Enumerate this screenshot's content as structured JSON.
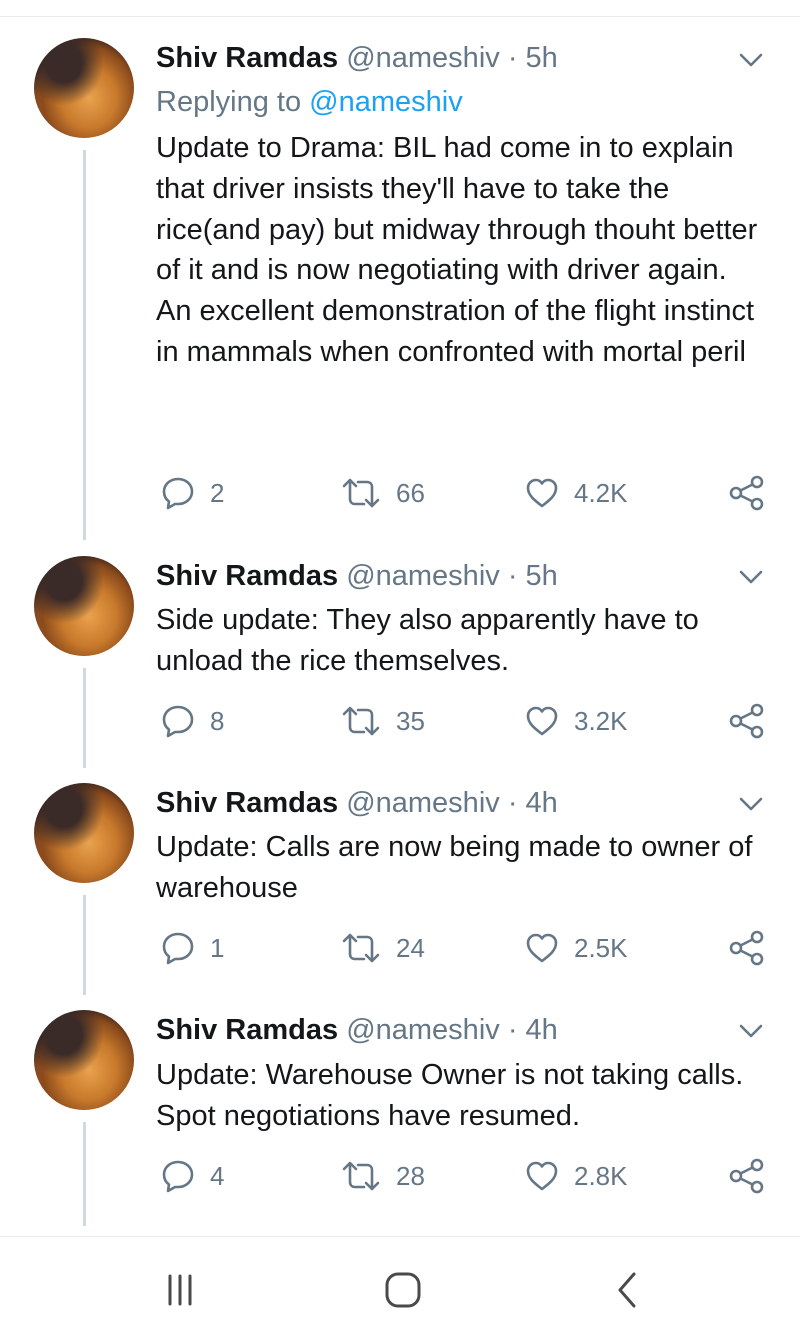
{
  "tweets": [
    {
      "name": "Shiv Ramdas",
      "meta": "@nameshiv · 5h",
      "replying_prefix": "Replying to ",
      "replying_handle": "@nameshiv",
      "text": "Update to Drama: BIL had come in to explain that driver insists they'll have to take the rice(and pay) but midway through thouht better of it and is now negotiating with driver again. An excellent demonstration of the flight instinct in mammals when confronted with mortal peril",
      "replies": "2",
      "retweets": "66",
      "likes": "4.2K"
    },
    {
      "name": "Shiv Ramdas",
      "meta": "@nameshiv · 5h",
      "text": "Side update: They also apparently have to unload the rice themselves.",
      "replies": "8",
      "retweets": "35",
      "likes": "3.2K"
    },
    {
      "name": "Shiv Ramdas",
      "meta": "@nameshiv · 4h",
      "text": "Update: Calls are now being made to owner of warehouse",
      "replies": "1",
      "retweets": "24",
      "likes": "2.5K"
    },
    {
      "name": "Shiv Ramdas",
      "meta": "@nameshiv · 4h",
      "text": "Update: Warehouse Owner is not taking calls. Spot negotiations have resumed.",
      "replies": "4",
      "retweets": "28",
      "likes": "2.8K"
    }
  ],
  "icons": {
    "reply": "reply-icon",
    "retweet": "retweet-icon",
    "like": "heart-icon",
    "share": "share-icon",
    "caret": "chevron-down-icon",
    "nav_recents": "recent-apps-icon",
    "nav_home": "home-icon",
    "nav_back": "back-icon"
  },
  "colors": {
    "text": "#14171a",
    "meta": "#657786",
    "link": "#1da1f2",
    "thread_line": "#cfd9de"
  }
}
